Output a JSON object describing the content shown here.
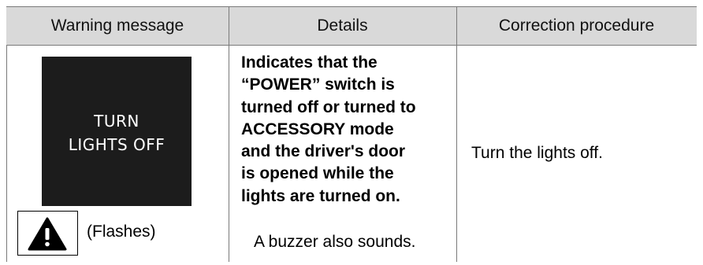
{
  "table": {
    "headers": [
      "Warning message",
      "Details",
      "Correction procedure"
    ],
    "row": {
      "warning_display_lines": [
        "TURN",
        "LIGHTS OFF"
      ],
      "indicator_icon": "warning-triangle-icon",
      "indicator_note": "(Flashes)",
      "details_bold": "Indicates that the\n“POWER” switch is\nturned off or turned to\nACCESSORY mode\nand the driver's door\nis opened while the\nlights are turned on.",
      "details_normal": "A buzzer also sounds.",
      "correction": "Turn the lights off."
    }
  },
  "colors": {
    "header_background": "#d9d9d9",
    "display_background": "#1c1c1c",
    "display_text": "#ffffff",
    "rule_line": "#7a7a7a"
  }
}
